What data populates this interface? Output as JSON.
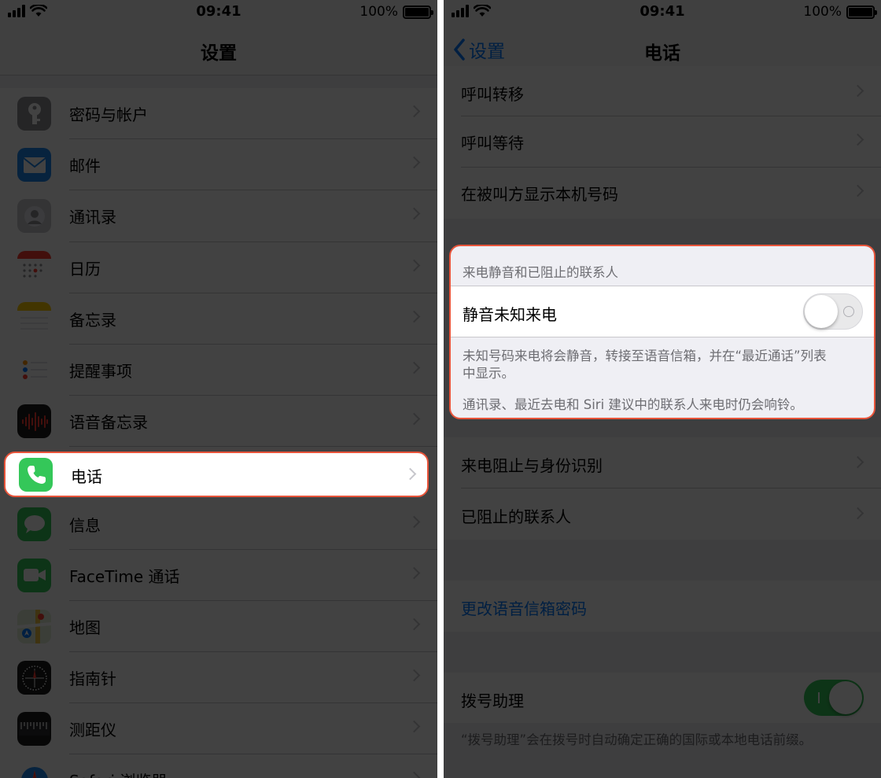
{
  "status_bar": {
    "time": "09:41",
    "battery": "100%",
    "battery_level": 1.0
  },
  "left": {
    "nav_title": "设置",
    "items": [
      {
        "label": "密码与帐户",
        "icon": "key-icon",
        "color": "#8e8e93"
      },
      {
        "label": "邮件",
        "icon": "mail-icon",
        "color": "#1e88f0"
      },
      {
        "label": "通讯录",
        "icon": "contacts-icon",
        "color": "#b0b0b5"
      },
      {
        "label": "日历",
        "icon": "calendar-icon",
        "color": "#ffffff"
      },
      {
        "label": "备忘录",
        "icon": "notes-icon",
        "color": "#ffffff"
      },
      {
        "label": "提醒事项",
        "icon": "reminders-icon",
        "color": "#ffffff"
      },
      {
        "label": "语音备忘录",
        "icon": "voice-memos-icon",
        "color": "#1c1c1e"
      },
      {
        "label": "电话",
        "icon": "phone-icon",
        "color": "#34c759"
      },
      {
        "label": "信息",
        "icon": "messages-icon",
        "color": "#34c759"
      },
      {
        "label": "FaceTime 通话",
        "icon": "facetime-icon",
        "color": "#34c759"
      },
      {
        "label": "地图",
        "icon": "maps-icon",
        "color": "#d8e6c8"
      },
      {
        "label": "指南针",
        "icon": "compass-icon",
        "color": "#1c1c1e"
      },
      {
        "label": "测距仪",
        "icon": "measure-icon",
        "color": "#1c1c1e"
      },
      {
        "label": "Safari 浏览器",
        "icon": "safari-icon",
        "color": "#1e88f0"
      }
    ]
  },
  "right": {
    "back_label": "设置",
    "nav_title": "电话",
    "group1": [
      "呼叫转移",
      "呼叫等待",
      "在被叫方显示本机号码"
    ],
    "silence_section": {
      "header": "来电静音和已阻止的联系人",
      "toggle_label": "静音未知来电",
      "toggle_on": false,
      "footer_line1": "未知号码来电将会静音，转接至语音信箱，并在“最近通话”列表",
      "footer_line2": "中显示。",
      "footer_line3": "通讯录、最近去电和 Siri 建议中的联系人来电时仍会响铃。"
    },
    "group2": [
      "来电阻止与身份识别",
      "已阻止的联系人"
    ],
    "voicemail_link": "更改语音信箱密码",
    "dial_assist": {
      "label": "拨号助理",
      "toggle_on": true,
      "footer": "“拨号助理”会在拨号时自动确定正确的国际或本地电话前缀。"
    }
  },
  "colors": {
    "accent": "#007aff",
    "highlight_border": "#e8543a",
    "toggle_on": "#34c759"
  }
}
